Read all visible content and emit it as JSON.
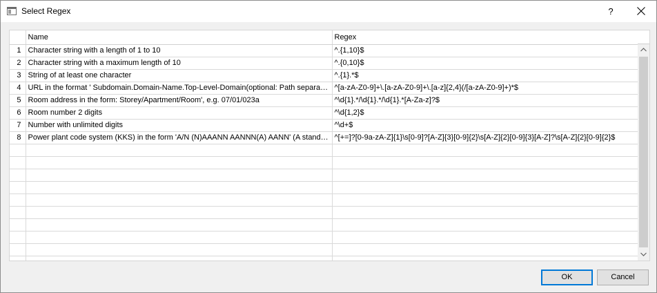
{
  "window": {
    "title": "Select Regex",
    "help_label": "?"
  },
  "table": {
    "columns": [
      "",
      "Name",
      "Regex"
    ],
    "rows": [
      {
        "num": "1",
        "name": "Character string with a length of 1 to 10",
        "regex": "^.{1,10}$"
      },
      {
        "num": "2",
        "name": "Character string with a maximum length of 10",
        "regex": "^.{0,10}$"
      },
      {
        "num": "3",
        "name": "String of at least one character",
        "regex": "^.{1}.*$"
      },
      {
        "num": "4",
        "name": "URL in the format ' Subdomain.Domain-Name.Top-Level-Domain(optional: Path separated b...",
        "regex": "^[a-zA-Z0-9]+\\.[a-zA-Z0-9]+\\.[a-z]{2,4}(/[a-zA-Z0-9]+)*$"
      },
      {
        "num": "5",
        "name": "Room address in the form: Storey/Apartment/Room', e.g. 07/01/023a",
        "regex": "^\\d{1}.*/\\d{1}.*/\\d{1}.*[A-Za-z]?$"
      },
      {
        "num": "6",
        "name": "Room number 2 digits",
        "regex": "^\\d{1,2}$"
      },
      {
        "num": "7",
        "name": "Number with unlimited digits",
        "regex": "^\\d+$"
      },
      {
        "num": "8",
        "name": "Power plant code system (KKS) in the form 'A/N (N)AAANN AANNN(A) AANN' (A stands for ...",
        "regex": "^[+=]?[0-9a-zA-Z]{1}\\s[0-9]?[A-Z]{3}[0-9]{2}\\s[A-Z]{2}[0-9]{3}[A-Z]?\\s[A-Z]{2}[0-9]{2}$"
      }
    ],
    "empty_rows": 10
  },
  "buttons": {
    "ok": "OK",
    "cancel": "Cancel"
  }
}
